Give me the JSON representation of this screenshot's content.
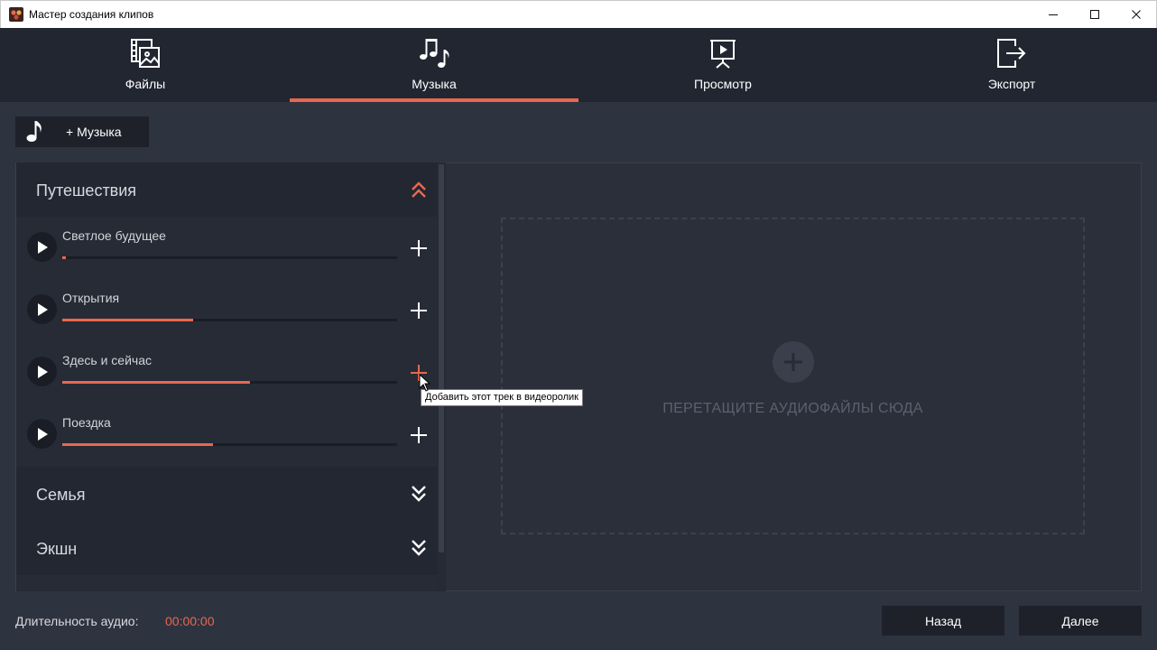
{
  "window": {
    "title": "Мастер создания клипов"
  },
  "steps": [
    {
      "label": "Файлы",
      "icon": "files-icon",
      "active": false
    },
    {
      "label": "Музыка",
      "icon": "music-notes-icon",
      "active": true
    },
    {
      "label": "Просмотр",
      "icon": "preview-icon",
      "active": false
    },
    {
      "label": "Экспорт",
      "icon": "export-icon",
      "active": false
    }
  ],
  "toolbar": {
    "add_music_label": "+ Музыка"
  },
  "library": {
    "categories": [
      {
        "title": "Путешествия",
        "expanded": true,
        "tracks": [
          {
            "name": "Светлое будущее",
            "progress": 0.01
          },
          {
            "name": "Открытия",
            "progress": 0.39
          },
          {
            "name": "Здесь и сейчас",
            "progress": 0.56
          },
          {
            "name": "Поездка",
            "progress": 0.45
          }
        ]
      },
      {
        "title": "Семья",
        "expanded": false
      },
      {
        "title": "Экшн",
        "expanded": false
      }
    ]
  },
  "tooltip": {
    "text": "Добавить этот трек в видеоролик"
  },
  "drop_area": {
    "text": "ПЕРЕТАЩИТЕ АУДИОФАЙЛЫ СЮДА"
  },
  "footer": {
    "duration_label": "Длительность аудио:",
    "duration_value": "00:00:00",
    "back_label": "Назад",
    "next_label": "Далее"
  },
  "colors": {
    "accent": "#e8684f",
    "background": "#2e3340",
    "header": "#222631",
    "button": "#1e2129"
  }
}
